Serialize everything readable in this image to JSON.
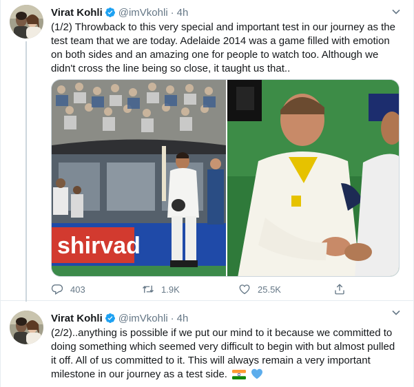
{
  "tweets": [
    {
      "author": {
        "name": "Virat Kohli",
        "handle": "@imVkohli",
        "verified": true
      },
      "separator": "·",
      "time": "4h",
      "text": "(1/2) Throwback to this very special and important test in our journey as the test team that we are today. Adelaide 2014 was a game filled with emotion on both sides and an amazing one for people to watch too. Although we didn't cross the line being so close, it taught us that..",
      "media": {
        "icon": "photo-grid",
        "photos": [
          {
            "name": "kohli-walking-back-photo",
            "banner_text": "shirvad"
          },
          {
            "name": "handshake-photo"
          }
        ]
      },
      "actions": {
        "reply_count": "403",
        "retweet_count": "1.9K",
        "like_count": "25.5K"
      }
    },
    {
      "author": {
        "name": "Virat Kohli",
        "handle": "@imVkohli",
        "verified": true
      },
      "separator": "·",
      "time": "4h",
      "text": "(2/2)..anything is possible if we put our mind to it because we committed to doing something which seemed very difficult to begin with but almost pulled it off. All of us committed to it. This will always remain a very important milestone in our journey as a test side.",
      "emojis": [
        "india-flag-icon",
        "blue-heart-icon"
      ]
    }
  ],
  "colors": {
    "verified_blue": "#1da1f2",
    "text_primary": "#14171a",
    "text_secondary": "#657786",
    "thread_line": "#ccd6dd"
  }
}
